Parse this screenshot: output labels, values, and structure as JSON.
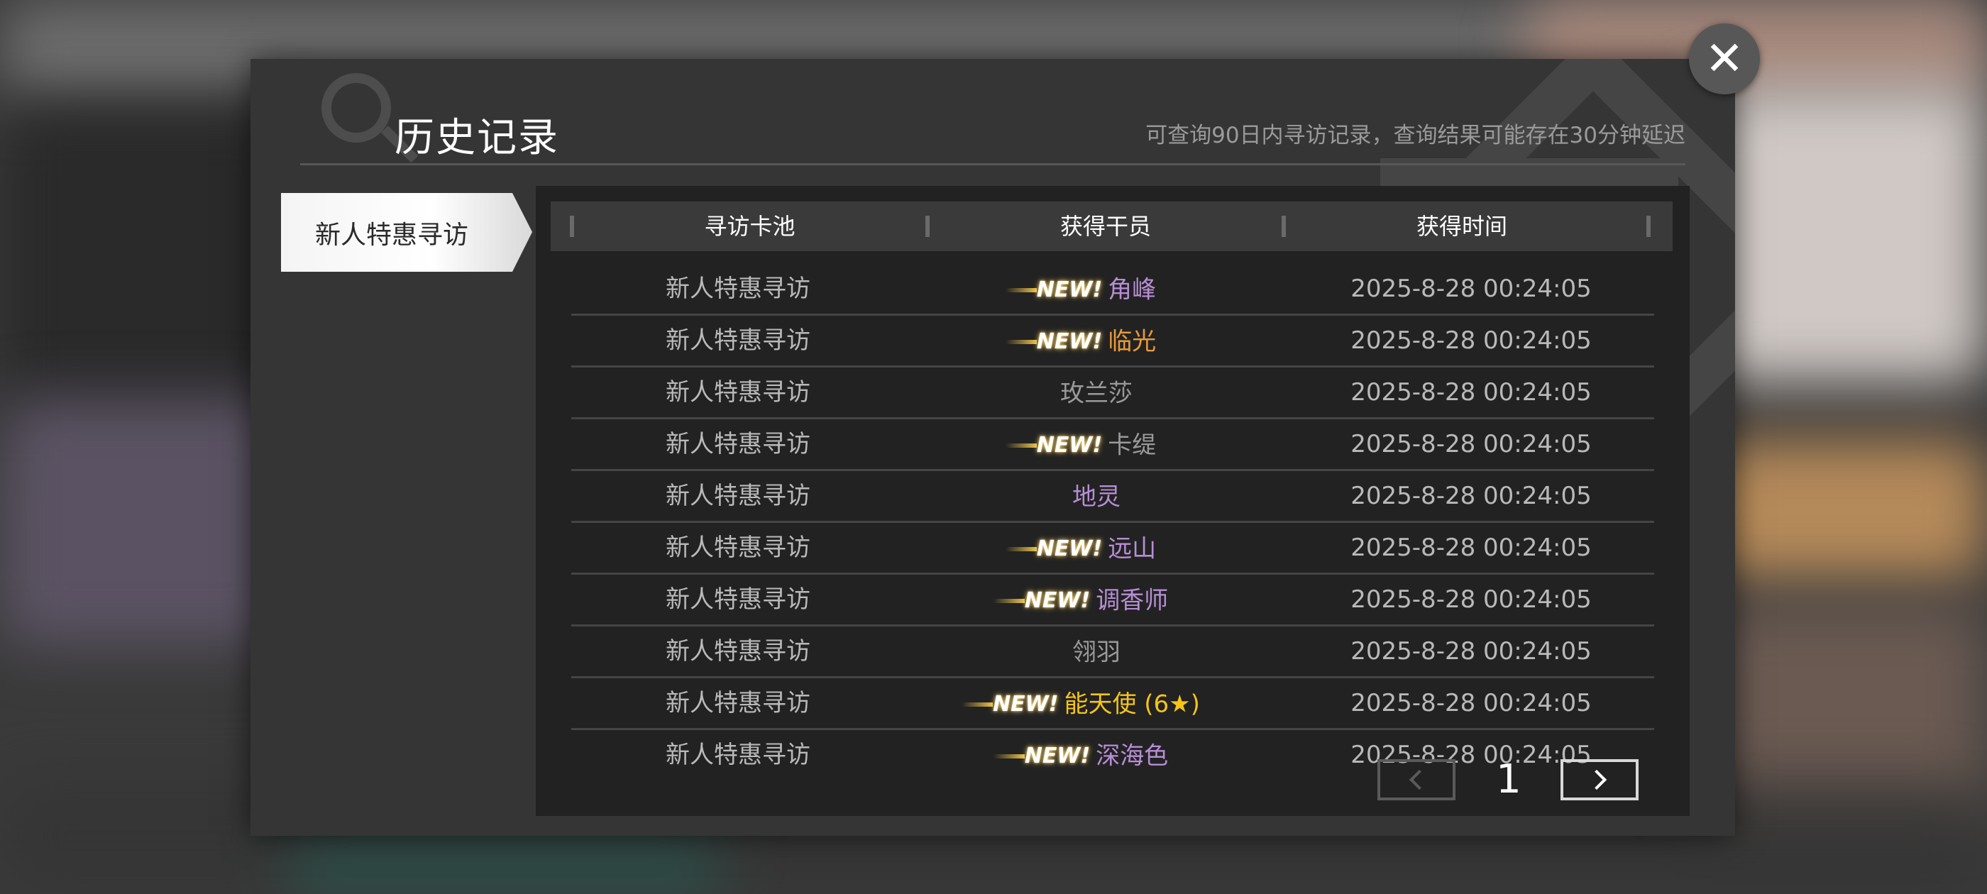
{
  "header": {
    "title": "历史记录",
    "subtitle": "可查询90日内寻访记录，查询结果可能存在30分钟延迟"
  },
  "tabs": [
    {
      "label": "新人特惠寻访",
      "selected": true
    }
  ],
  "table": {
    "columns": [
      "寻访卡池",
      "获得干员",
      "获得时间"
    ],
    "new_tag": "NEW!",
    "rows": [
      {
        "pool": "新人特惠寻访",
        "operator": "角峰",
        "is_new": true,
        "color": "#b78ed6",
        "time": "2025-8-28 00:24:05"
      },
      {
        "pool": "新人特惠寻访",
        "operator": "临光",
        "is_new": true,
        "color": "#e89a3c",
        "time": "2025-8-28 00:24:05"
      },
      {
        "pool": "新人特惠寻访",
        "operator": "玫兰莎",
        "is_new": false,
        "color": "#9a9a9a",
        "time": "2025-8-28 00:24:05"
      },
      {
        "pool": "新人特惠寻访",
        "operator": "卡缇",
        "is_new": true,
        "color": "#9a9a9a",
        "time": "2025-8-28 00:24:05"
      },
      {
        "pool": "新人特惠寻访",
        "operator": "地灵",
        "is_new": false,
        "color": "#b78ed6",
        "time": "2025-8-28 00:24:05"
      },
      {
        "pool": "新人特惠寻访",
        "operator": "远山",
        "is_new": true,
        "color": "#b78ed6",
        "time": "2025-8-28 00:24:05"
      },
      {
        "pool": "新人特惠寻访",
        "operator": "调香师",
        "is_new": true,
        "color": "#b78ed6",
        "time": "2025-8-28 00:24:05"
      },
      {
        "pool": "新人特惠寻访",
        "operator": "翎羽",
        "is_new": false,
        "color": "#9a9a9a",
        "time": "2025-8-28 00:24:05"
      },
      {
        "pool": "新人特惠寻访",
        "operator": "能天使 (6★)",
        "is_new": true,
        "color": "#f5c518",
        "time": "2025-8-28 00:24:05"
      },
      {
        "pool": "新人特惠寻访",
        "operator": "深海色",
        "is_new": true,
        "color": "#b78ed6",
        "time": "2025-8-28 00:24:05"
      }
    ]
  },
  "pagination": {
    "current_page": "1",
    "prev_icon": "chevron-left-icon",
    "next_icon": "chevron-right-icon"
  },
  "close_icon": "close-icon",
  "close_glyph": "✕"
}
